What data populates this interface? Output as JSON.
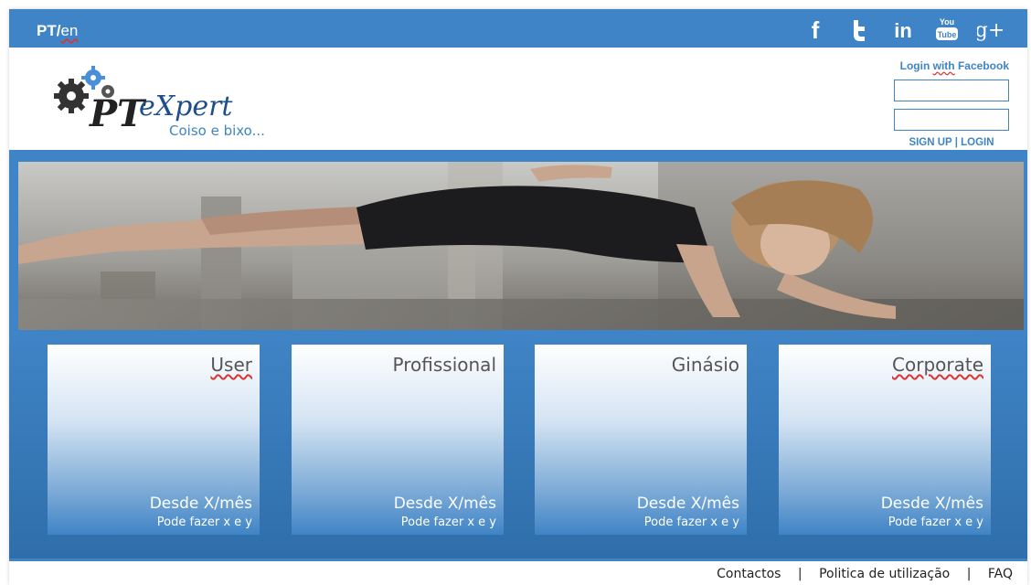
{
  "topbar": {
    "lang_pt": "PT",
    "lang_sep": "/",
    "lang_en": "en",
    "social_icons": [
      "facebook-icon",
      "twitter-icon",
      "linkedin-icon",
      "youtube-icon",
      "google-plus-icon"
    ],
    "facebook_glyph": "f",
    "twitter_glyph": "t",
    "linkedin_glyph": "in",
    "youtube_top": "You",
    "youtube_bottom": "Tube",
    "gplus_glyph": "g+",
    "color": "#3f84c6"
  },
  "header": {
    "logo_text_pt": "PT",
    "logo_text_expert": "eXpert",
    "tagline": "Coiso e bixo...",
    "login_facebook_prefix": "Login ",
    "login_facebook_with": "with",
    "login_facebook_suffix": " Facebook",
    "username_value": "",
    "password_value": "",
    "signup_label": "SIGN UP",
    "auth_sep": "|",
    "login_label": "LOGIN"
  },
  "hero": {
    "image": "woman-plank-exercise-photo"
  },
  "plans": [
    {
      "title": "User",
      "price": "Desde X/mês",
      "desc": "Pode fazer x e y"
    },
    {
      "title": "Profissional",
      "price": "Desde X/mês",
      "desc": "Pode fazer x e y"
    },
    {
      "title": "Ginásio",
      "price": "Desde X/mês",
      "desc": "Pode fazer x e y"
    },
    {
      "title": "Corporate",
      "price": "Desde X/mês",
      "desc": "Pode fazer x e y"
    }
  ],
  "footer": {
    "contacts": "Contactos",
    "sep": "|",
    "policy": "Politica de utilização",
    "faq": "FAQ"
  }
}
